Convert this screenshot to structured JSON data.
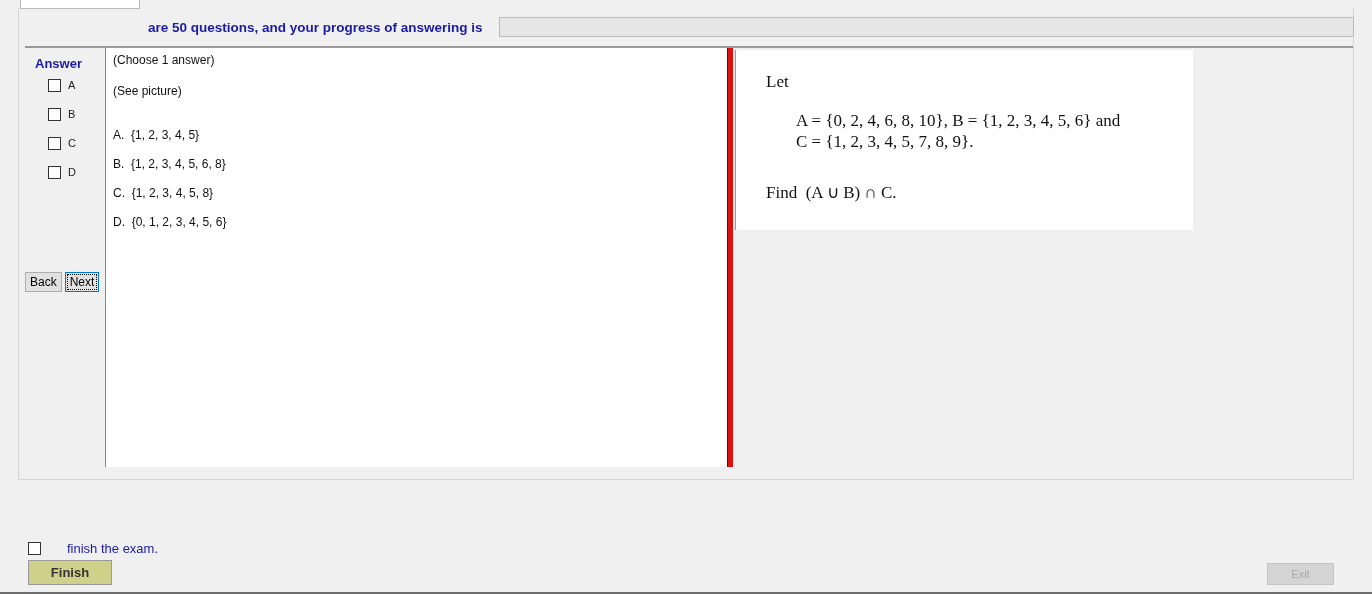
{
  "header": {
    "text": "are 50 questions, and your progress of answering is",
    "progress": {
      "level": 0
    }
  },
  "answer_panel": {
    "title": "Answer",
    "options": [
      {
        "label": "A",
        "checked": false
      },
      {
        "label": "B",
        "checked": false
      },
      {
        "label": "C",
        "checked": false
      },
      {
        "label": "D",
        "checked": false
      }
    ],
    "buttons": [
      {
        "label": "Back",
        "focused": false
      },
      {
        "label": "Next",
        "focused": true
      }
    ]
  },
  "question": {
    "lines": [
      "(Choose 1 answer)",
      "(See picture)"
    ],
    "choices": [
      "A.  {1, 2, 3, 4, 5}",
      "B.  {1, 2, 3, 4, 5, 6, 8}",
      "C.  {1, 2, 3, 4, 5, 8}",
      "D.  {0, 1, 2, 3, 4, 5, 6}"
    ]
  },
  "picture_text": {
    "intro": "Let",
    "sets": [
      "A = {0, 2, 4, 6, 8, 10}, B = {1, 2, 3, 4, 5, 6} and",
      "C = {1, 2, 3, 4, 5, 7, 8, 9}."
    ],
    "task": "Find  (A ∪ B) ∩ C."
  },
  "footer": {
    "finish_check": {
      "label": "finish the exam.",
      "checked": false
    },
    "finish_button": {
      "label": "Finish"
    },
    "exit_button": {
      "label": "Exit",
      "disabled": true
    }
  }
}
